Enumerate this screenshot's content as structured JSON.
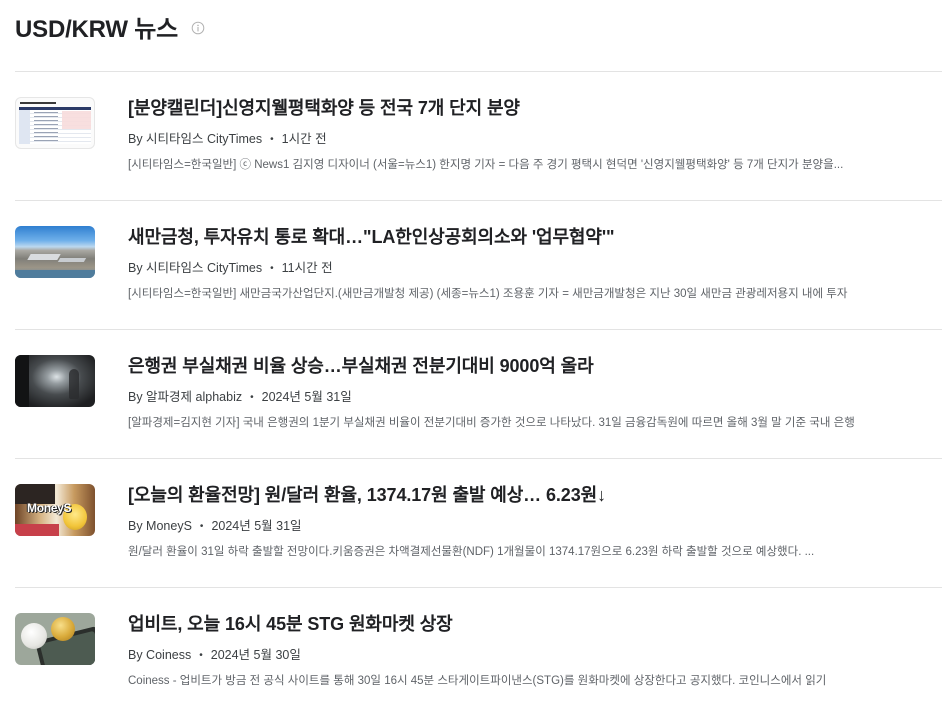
{
  "header": {
    "title": "USD/KRW 뉴스",
    "info_icon": "info-icon"
  },
  "colors": {
    "title": "#202124",
    "meta": "#3c4043",
    "snippet": "#5f6368",
    "divider": "#e3e3e3"
  },
  "separator": "•",
  "news": [
    {
      "title": "[분양캘린더]신영지웰평택화양 등 전국 7개 단지 분양",
      "source": "By 시티타임스 CityTimes",
      "time": "1시간 전",
      "snippet": "[시티타임스=한국일반] ⓒ News1 김지영 디자이너 (서울=뉴스1) 한지명 기자 = 다음 주 경기 평택시 현덕면 '신영지웰평택화양' 등 7개 단지가 분양을..."
    },
    {
      "title": "새만금청, 투자유치 통로 확대…\"LA한인상공회의소와 '업무협약'\"",
      "source": "By 시티타임스 CityTimes",
      "time": "11시간 전",
      "snippet": "[시티타임스=한국일반] 새만금국가산업단지.(새만금개발청 제공) (세종=뉴스1) 조용훈 기자 = 새만금개발청은 지난 30일 새만금 관광레저용지 내에 투자"
    },
    {
      "title": "은행권 부실채권 비율 상승…부실채권 전분기대비 9000억 올라",
      "source": "By 알파경제 alphabiz",
      "time": "2024년 5월 31일",
      "snippet": "[알파경제=김지현 기자] 국내 은행권의 1분기 부실채권 비율이 전분기대비 증가한 것으로 나타났다. 31일 금융감독원에 따르면 올해 3월 말 기준 국내 은행"
    },
    {
      "title": "[오늘의 환율전망] 원/달러 환율, 1374.17원 출발 예상… 6.23원↓",
      "source": "By MoneyS",
      "time": "2024년 5월 31일",
      "snippet": "원/달러 환율이 31일 하락 출발할 전망이다.키움증권은 차액결제선물환(NDF) 1개월물이 1374.17원으로 6.23원 하락 출발할 것으로 예상했다. ...",
      "thumbnail_text": "MoneyS"
    },
    {
      "title": "업비트, 오늘 16시 45분 STG 원화마켓 상장",
      "source": "By Coiness",
      "time": "2024년 5월 30일",
      "snippet": "Coiness - 업비트가 방금 전 공식 사이트를 통해 30일 16시 45분 스타게이트파이낸스(STG)를 원화마켓에 상장한다고 공지했다. 코인니스에서 읽기"
    }
  ]
}
